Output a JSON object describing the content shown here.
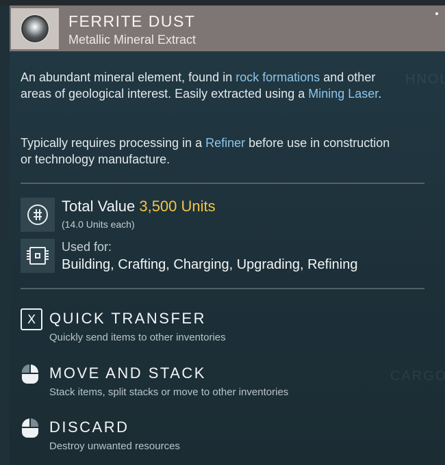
{
  "item": {
    "name": "FERRITE DUST",
    "subtitle": "Metallic Mineral Extract",
    "icon": "ferrite-orb-icon"
  },
  "description": {
    "p1": {
      "t1": "An abundant mineral element, found in ",
      "link1": "rock formations",
      "t2": " and other areas of geological interest. Easily extracted using a ",
      "link2": "Mining Laser",
      "t3": "."
    },
    "p2": {
      "t1": "Typically requires processing in a ",
      "link1": "Refiner",
      "t2": " before use in construction or technology manufacture."
    }
  },
  "value": {
    "label": "Total Value",
    "amount": "3,500 Units",
    "each": "(14.0 Units each)"
  },
  "usage": {
    "label": "Used for:",
    "list": "Building, Crafting, Charging, Upgrading, Refining"
  },
  "actions": [
    {
      "key": "X",
      "label": "QUICK TRANSFER",
      "hint": "Quickly send items to other inventories"
    },
    {
      "label": "MOVE AND STACK",
      "hint": "Stack items, split stacks or move to other inventories"
    },
    {
      "label": "DISCARD",
      "hint": "Destroy unwanted resources"
    }
  ],
  "background_text": [
    "HNOL",
    "CARGO"
  ],
  "colors": {
    "header": "#7d7674",
    "panel": "#1f3038",
    "value_highlight": "#f4c542",
    "link": "#8fc5ea"
  }
}
